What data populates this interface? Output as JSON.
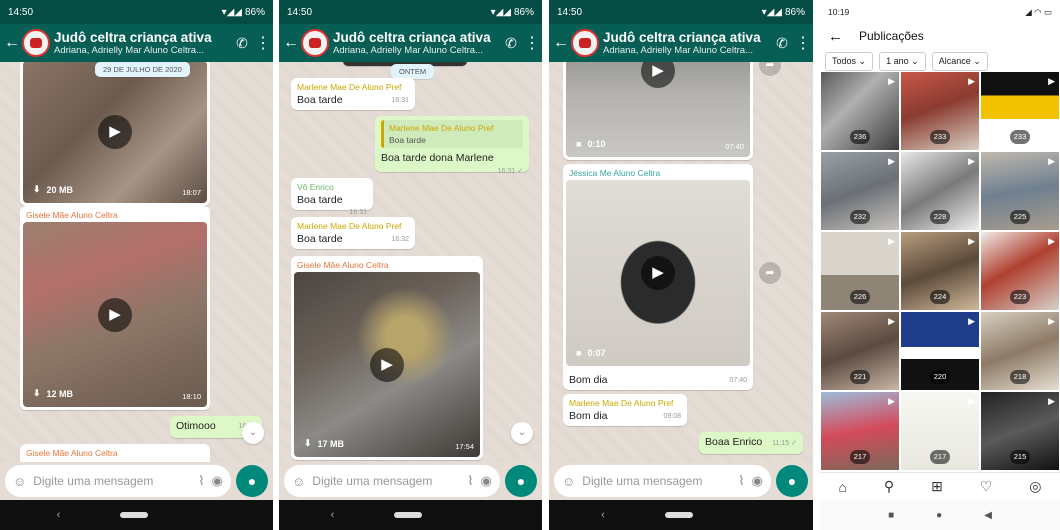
{
  "panel1": {
    "status_time": "14:50",
    "battery": "86%",
    "title": "Judô celtra criança ativa",
    "subtitle": "Adriana, Adrielly Mar Aluno Celtra...",
    "date_pill": "29 DE JULHO DE 2020",
    "video1": {
      "size": "20 MB",
      "time": "18:07"
    },
    "msg2_sender": "Gisele Mãe Aluno Celtra",
    "video2": {
      "size": "12 MB",
      "time": "18:10"
    },
    "out_msg": {
      "text": "Otimooo",
      "time": "18:10"
    },
    "bottom_sender": "Gisele Mãe Aluno Celtra",
    "input_placeholder": "Digite uma mensagem"
  },
  "panel2": {
    "status_time": "14:50",
    "battery": "86%",
    "title": "Judô celtra criança ativa",
    "subtitle": "Adriana, Adrielly Mar Aluno Celtra...",
    "date_pill": "ONTEM",
    "msg1": {
      "sender": "Marlene Mae De Aluno Pref",
      "text": "Boa tarde",
      "time": "16:31"
    },
    "reply": {
      "quoted_sender": "Marlene Mae De Aluno Pref",
      "quoted_text": "Boa tarde",
      "text": "Boa tarde dona Marlene",
      "time": "16:31"
    },
    "msg3": {
      "sender": "Vô Enrico",
      "text": "Boa tarde",
      "time": "16:31"
    },
    "msg4": {
      "sender": "Marlene Mae De Aluno Pref",
      "text": "Boa tarde",
      "time": "16:32"
    },
    "msg5_sender": "Gisele Mãe Aluno Celtra",
    "video": {
      "size": "17 MB",
      "time": "17:54"
    },
    "input_placeholder": "Digite uma mensagem"
  },
  "panel3": {
    "status_time": "14:50",
    "battery": "86%",
    "title": "Judô celtra criança ativa",
    "subtitle": "Adriana, Adrielly Mar Aluno Celtra...",
    "video1": {
      "duration": "0:10",
      "time": "07:40"
    },
    "msg2": {
      "sender": "Jéssica Me Aluno Celtra",
      "duration": "0:07",
      "text": "Bom dia",
      "time": "07:40"
    },
    "msg3": {
      "sender": "Marlene Mae De Aluno Pref",
      "text": "Bom dia",
      "time": "09:08"
    },
    "out_msg": {
      "text": "Boaa Enrico",
      "time": "11:15"
    },
    "input_placeholder": "Digite uma mensagem"
  },
  "panel4": {
    "status_time": "10:19",
    "header_title": "Publicações",
    "filters": [
      "Todos",
      "1 ano",
      "Alcance"
    ],
    "tiles": [
      {
        "count": "236",
        "style": "t1"
      },
      {
        "count": "233",
        "style": "t2"
      },
      {
        "count": "233",
        "style": "t3"
      },
      {
        "count": "232",
        "style": "t4"
      },
      {
        "count": "228",
        "style": "t5"
      },
      {
        "count": "225",
        "style": "t6"
      },
      {
        "count": "226",
        "style": "t7"
      },
      {
        "count": "224",
        "style": "t8"
      },
      {
        "count": "223",
        "style": "t9"
      },
      {
        "count": "221",
        "style": "t10"
      },
      {
        "count": "220",
        "style": "t11"
      },
      {
        "count": "218",
        "style": "t12"
      },
      {
        "count": "217",
        "style": "t13"
      },
      {
        "count": "217",
        "style": "t14"
      },
      {
        "count": "215",
        "style": "t15"
      }
    ]
  },
  "colors": {
    "whatsapp_header": "#075e54",
    "status_bar": "#054d44",
    "mic_button": "#00897b",
    "outgoing_bubble": "#dcf8c6",
    "chat_bg": "#e5ddd5"
  },
  "icons": [
    "back-arrow-icon",
    "add-call-icon",
    "more-vert-icon",
    "play-icon",
    "download-icon",
    "emoji-icon",
    "attach-icon",
    "camera-icon",
    "mic-icon",
    "double-check-icon",
    "video-camera-icon",
    "forward-icon",
    "chevron-down-icon",
    "home-icon",
    "search-icon",
    "add-post-icon",
    "heart-icon",
    "profile-icon"
  ]
}
